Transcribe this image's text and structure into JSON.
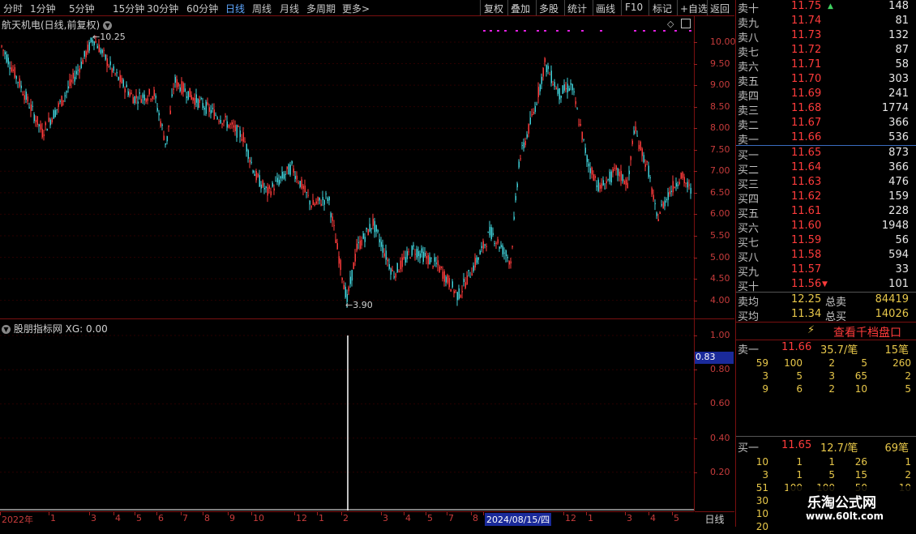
{
  "toolbar": {
    "tabs": [
      "分时",
      "1分钟",
      "5分钟",
      "15分钟",
      "30分钟",
      "60分钟",
      "日线",
      "周线",
      "月线",
      "多周期",
      "更多"
    ],
    "more_arrow": ">",
    "buttons": [
      "复权",
      "叠加",
      "多股",
      "统计",
      "画线",
      "F10",
      "标记",
      "+自选",
      "返回"
    ]
  },
  "chart": {
    "title": "航天机电(日线,前复权)",
    "high_label": "10.25",
    "low_label": "3.90",
    "y_labels": [
      "10.00",
      "9.50",
      "9.00",
      "8.50",
      "8.00",
      "7.50",
      "7.00",
      "6.50",
      "6.00",
      "5.50",
      "5.00",
      "4.50",
      "4.00"
    ]
  },
  "indicator": {
    "title": "股朋指标网 XG: 0.00",
    "y_labels": [
      "1.00",
      "0.80",
      "0.60",
      "0.40",
      "0.20"
    ],
    "cursor_value": "0.83"
  },
  "date_axis": {
    "labels": [
      "2022年",
      "1",
      "3",
      "4",
      "5",
      "6",
      "7",
      "8",
      "9",
      "10",
      "12",
      "1",
      "2",
      "3",
      "4",
      "5",
      "7",
      "8",
      "2024/08/15/四",
      "12",
      "1",
      "3",
      "4",
      "5"
    ],
    "period": "日线"
  },
  "orderbook": {
    "asks": [
      {
        "label": "卖十",
        "price": "11.75",
        "vol": "148"
      },
      {
        "label": "卖九",
        "price": "11.74",
        "vol": "81"
      },
      {
        "label": "卖八",
        "price": "11.73",
        "vol": "132"
      },
      {
        "label": "卖七",
        "price": "11.72",
        "vol": "87"
      },
      {
        "label": "卖六",
        "price": "11.71",
        "vol": "58"
      },
      {
        "label": "卖五",
        "price": "11.70",
        "vol": "303"
      },
      {
        "label": "卖四",
        "price": "11.69",
        "vol": "241"
      },
      {
        "label": "卖三",
        "price": "11.68",
        "vol": "1774"
      },
      {
        "label": "卖二",
        "price": "11.67",
        "vol": "366"
      },
      {
        "label": "卖一",
        "price": "11.66",
        "vol": "536"
      }
    ],
    "bids": [
      {
        "label": "买一",
        "price": "11.65",
        "vol": "873"
      },
      {
        "label": "买二",
        "price": "11.64",
        "vol": "366"
      },
      {
        "label": "买三",
        "price": "11.63",
        "vol": "476"
      },
      {
        "label": "买四",
        "price": "11.62",
        "vol": "159"
      },
      {
        "label": "买五",
        "price": "11.61",
        "vol": "228"
      },
      {
        "label": "买六",
        "price": "11.60",
        "vol": "1948"
      },
      {
        "label": "买七",
        "price": "11.59",
        "vol": "56"
      },
      {
        "label": "买八",
        "price": "11.58",
        "vol": "594"
      },
      {
        "label": "买九",
        "price": "11.57",
        "vol": "33"
      },
      {
        "label": "买十",
        "price": "11.56",
        "vol": "101"
      }
    ],
    "avg_sell_label": "卖均",
    "avg_sell": "12.25",
    "total_sell_label": "总卖",
    "total_sell": "84419",
    "avg_buy_label": "买均",
    "avg_buy": "11.34",
    "total_buy_label": "总买",
    "total_buy": "14026"
  },
  "depth": {
    "button": "查看千档盘口",
    "sell1_label": "卖一",
    "sell1_price": "11.66",
    "sell1_per": "35.7/笔",
    "sell1_count": "15笔",
    "sell_rows": [
      [
        "59",
        "100",
        "2",
        "5",
        "260"
      ],
      [
        "3",
        "5",
        "3",
        "65",
        "2"
      ],
      [
        "9",
        "6",
        "2",
        "10",
        "5"
      ]
    ],
    "buy1_label": "买一",
    "buy1_price": "11.65",
    "buy1_per": "12.7/笔",
    "buy1_count": "69笔",
    "buy_rows": [
      [
        "10",
        "1",
        "1",
        "26",
        "1"
      ],
      [
        "3",
        "1",
        "5",
        "15",
        "2"
      ],
      [
        "51",
        "100",
        "100",
        "50",
        "10"
      ],
      [
        "30",
        "",
        "",
        "",
        ""
      ],
      [
        "10",
        "",
        "",
        "",
        ""
      ],
      [
        "20",
        "",
        "",
        "",
        ""
      ]
    ]
  },
  "watermark": {
    "name": "乐淘公式网",
    "url": "www.60lt.com"
  },
  "colors": {
    "up": "#ff3b3b",
    "down": "#3fd0d8",
    "accent": "#5fa7ff",
    "border": "#7a1010"
  }
}
